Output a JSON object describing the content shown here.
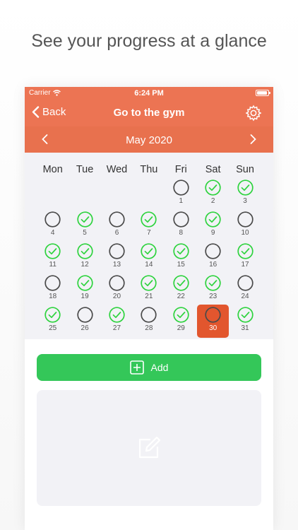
{
  "headline": "See your progress at a glance",
  "status": {
    "carrier": "Carrier",
    "time": "6:24 PM",
    "battery_level": 0.9
  },
  "nav": {
    "back_label": "Back",
    "title": "Go to the gym",
    "settings_icon": "gear-icon"
  },
  "month": {
    "label": "May 2020",
    "prev_icon": "chevron-left-icon",
    "next_icon": "chevron-right-icon"
  },
  "weekdays": [
    "Mon",
    "Tue",
    "Wed",
    "Thu",
    "Fri",
    "Sat",
    "Sun"
  ],
  "calendar": {
    "leading_blank_days": 4,
    "today": "30",
    "days": [
      {
        "day": "1",
        "done": false
      },
      {
        "day": "2",
        "done": true
      },
      {
        "day": "3",
        "done": true
      },
      {
        "day": "4",
        "done": false
      },
      {
        "day": "5",
        "done": true
      },
      {
        "day": "6",
        "done": false
      },
      {
        "day": "7",
        "done": true
      },
      {
        "day": "8",
        "done": false
      },
      {
        "day": "9",
        "done": true
      },
      {
        "day": "10",
        "done": false
      },
      {
        "day": "11",
        "done": true
      },
      {
        "day": "12",
        "done": true
      },
      {
        "day": "13",
        "done": false
      },
      {
        "day": "14",
        "done": true
      },
      {
        "day": "15",
        "done": true
      },
      {
        "day": "16",
        "done": false
      },
      {
        "day": "17",
        "done": true
      },
      {
        "day": "18",
        "done": false
      },
      {
        "day": "19",
        "done": true
      },
      {
        "day": "20",
        "done": false
      },
      {
        "day": "21",
        "done": true
      },
      {
        "day": "22",
        "done": true
      },
      {
        "day": "23",
        "done": true
      },
      {
        "day": "24",
        "done": false
      },
      {
        "day": "25",
        "done": true
      },
      {
        "day": "26",
        "done": false
      },
      {
        "day": "27",
        "done": true
      },
      {
        "day": "28",
        "done": false
      },
      {
        "day": "29",
        "done": true
      },
      {
        "day": "30",
        "done": false
      },
      {
        "day": "31",
        "done": true
      }
    ]
  },
  "add_button": {
    "label": "Add",
    "icon": "plus-square-icon"
  },
  "note": {
    "icon": "edit-note-icon"
  },
  "colors": {
    "accent": "#EC7453",
    "today": "#E2562E",
    "done_green": "#34C759",
    "panel": "#F2F2F6"
  }
}
